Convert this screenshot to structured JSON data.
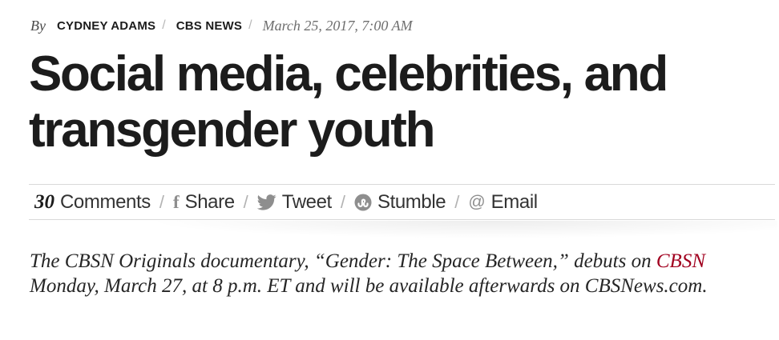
{
  "byline": {
    "by": "By",
    "author": "CYDNEY ADAMS",
    "source": "CBS NEWS",
    "date": "March 25, 2017, 7:00 AM",
    "separator": "/"
  },
  "headline": "Social media, celebrities, and transgender youth",
  "share_bar": {
    "comment_count": "30",
    "comments_label": "Comments",
    "separator": "/",
    "items": [
      {
        "icon": "facebook-icon",
        "label": "Share"
      },
      {
        "icon": "twitter-icon",
        "label": "Tweet"
      },
      {
        "icon": "stumbleupon-icon",
        "label": "Stumble"
      },
      {
        "icon": "at-icon",
        "label": "Email"
      }
    ]
  },
  "dek": {
    "before_link": "The CBSN Originals documentary, “Gender: The Space Between,” debuts on ",
    "link_text": "CBSN",
    "after_link": " Monday, March 27, at 8 p.m. ET and will be available afterwards on CBSNews.com."
  },
  "colors": {
    "link": "#a1001f",
    "text": "#1c1c1c",
    "icon": "#8e8e8e"
  }
}
